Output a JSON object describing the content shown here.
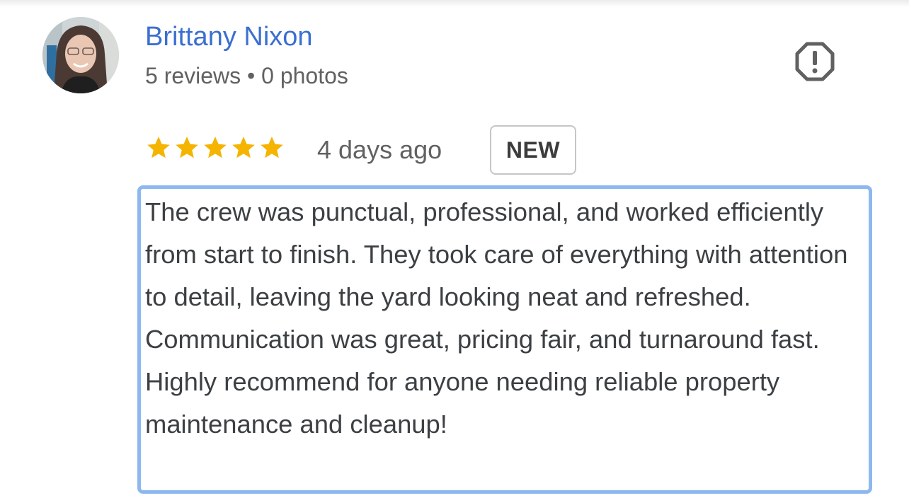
{
  "review": {
    "reviewer": {
      "name": "Brittany Nixon",
      "stats": "5 reviews • 0 photos",
      "avatar_icon": "reviewer-avatar-photo"
    },
    "report_icon": "report-flag-icon",
    "rating": {
      "stars": 5,
      "max_stars": 5,
      "star_icon": "star-icon",
      "star_color": "#f4b400"
    },
    "time_ago": "4 days ago",
    "badge": "NEW",
    "text": "The crew was punctual, professional, and worked efficiently from start to finish. They took care of everything with attention to detail, leaving the yard looking neat and refreshed. Communication was great, pricing fair, and turnaround fast. Highly recommend for anyone needing reliable property maintenance and cleanup!"
  },
  "colors": {
    "name_link": "#3b6fd0",
    "meta_text": "#616161",
    "body_text": "#3c4043",
    "highlight_border": "#8db8ef",
    "badge_border": "#c4c7c5"
  }
}
